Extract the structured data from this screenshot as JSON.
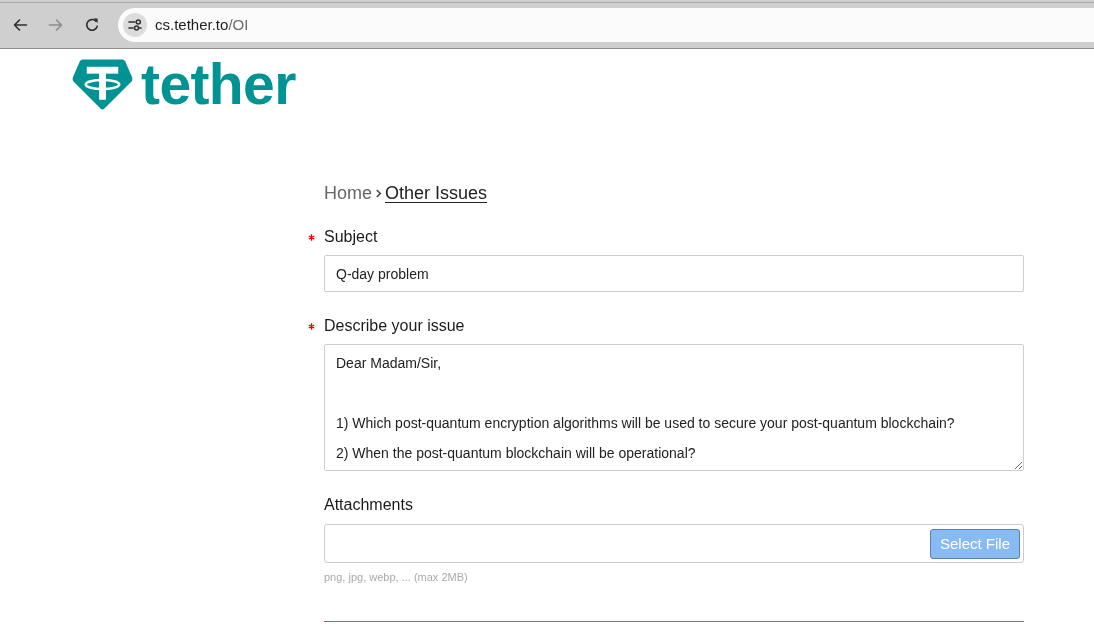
{
  "browser": {
    "nav_buttons": [
      {
        "kind": "back",
        "disabled": false
      },
      {
        "kind": "forward",
        "disabled": true
      },
      {
        "kind": "reload",
        "disabled": false
      }
    ],
    "url_host": "cs.tether.to",
    "url_path": "/OI"
  },
  "logo": {
    "text": "tether"
  },
  "breadcrumb": [
    {
      "label": "Home",
      "current": false
    },
    {
      "label": "Other Issues",
      "current": true
    }
  ],
  "fields": [
    {
      "kind": "text",
      "label": "Subject",
      "required": true,
      "value": "Q-day problem"
    },
    {
      "kind": "textarea",
      "label": "Describe your issue",
      "required": true,
      "value": "Dear Madam/Sir,\n\n1) Which post-quantum encryption algorithms will be used to secure your post-quantum blockchain?\n2) When the post-quantum blockchain will be operational?"
    },
    {
      "kind": "file",
      "label": "Attachments",
      "required": false,
      "button": "Select File",
      "hint": "png, jpg, webp, ... (max 2MB)"
    }
  ]
}
